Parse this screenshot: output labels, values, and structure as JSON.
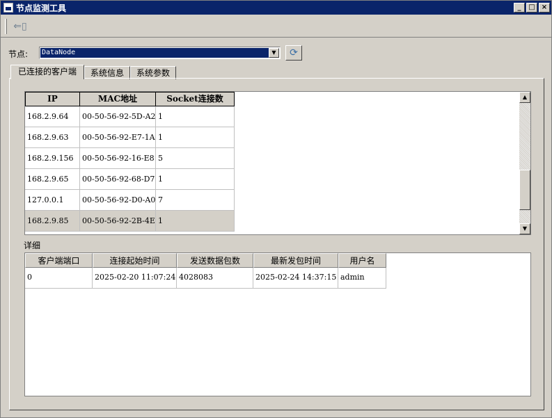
{
  "window": {
    "title": "节点监测工具"
  },
  "node": {
    "label": "节点:",
    "selected": "DataNode"
  },
  "tabs": [
    {
      "label": "已连接的客户端",
      "active": true
    },
    {
      "label": "系统信息",
      "active": false
    },
    {
      "label": "系统参数",
      "active": false
    }
  ],
  "clients": {
    "columns": [
      "IP",
      "MAC地址",
      "Socket连接数"
    ],
    "rows": [
      [
        "168.2.9.64",
        "00-50-56-92-5D-A2",
        "1"
      ],
      [
        "168.2.9.63",
        "00-50-56-92-E7-1A",
        "1"
      ],
      [
        "168.2.9.156",
        "00-50-56-92-16-E8",
        "5"
      ],
      [
        "168.2.9.65",
        "00-50-56-92-68-D7",
        "1"
      ],
      [
        "127.0.0.1",
        "00-50-56-92-D0-A0",
        "7"
      ],
      [
        "168.2.9.85",
        "00-50-56-92-2B-4E",
        "1"
      ]
    ]
  },
  "detail": {
    "label": "详细",
    "columns": [
      "客户端端口",
      "连接起始时间",
      "发送数据包数",
      "最新发包时间",
      "用户名"
    ],
    "rows": [
      [
        "0",
        "2025-02-20 11:07:24",
        "4028083",
        "2025-02-24 14:37:15",
        "admin"
      ]
    ]
  }
}
